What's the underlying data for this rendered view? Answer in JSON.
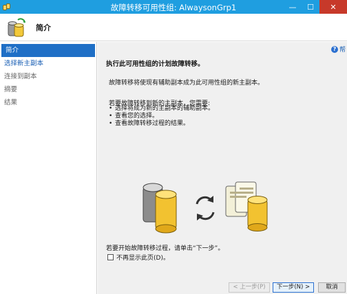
{
  "window": {
    "title": "故障转移可用性组: AlwaysonGrp1",
    "controls": {
      "minimize": "—",
      "maximize": "☐",
      "close": "✕"
    }
  },
  "header": {
    "title": "简介"
  },
  "sidebar": {
    "items": [
      {
        "label": "简介",
        "state": "active"
      },
      {
        "label": "选择新主副本",
        "state": "link"
      },
      {
        "label": "连接到副本",
        "state": "normal"
      },
      {
        "label": "摘要",
        "state": "normal"
      },
      {
        "label": "结果",
        "state": "normal"
      }
    ]
  },
  "main": {
    "help_label": "帮",
    "heading": "执行此可用性组的计划故障转移。",
    "description": "故障转移将使现有辅助副本成为此可用性组的新主副本。",
    "requirements_intro": "若要故障转移到新的主副本，您需要:",
    "requirements": [
      "选择将成为新的主副本的辅助副本。",
      "查看您的选择。",
      "查看故障转移过程的结果。"
    ],
    "instruction": "若要开始故障转移过程，请单击“下一步”。",
    "checkbox_label": "不再显示此页(D)。",
    "checkbox_checked": false
  },
  "footer": {
    "back_label": "< 上一步(P)",
    "next_label": "下一步(N) >",
    "cancel_label": "取消"
  },
  "colors": {
    "titlebar": "#1f9ee0",
    "active_nav": "#1f6fc6",
    "link": "#1a5fb4",
    "content_bg": "#f0f0f0"
  }
}
